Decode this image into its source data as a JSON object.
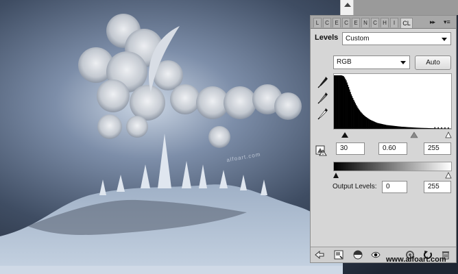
{
  "canvas": {
    "artwork_signature": "alfoart.com"
  },
  "panel": {
    "tabs": [
      "L",
      "C",
      "E",
      "C",
      "E",
      "N",
      "C",
      "H",
      "I",
      "S"
    ],
    "active_tab": "CL",
    "more_glyph": "▸▸",
    "menu_glyph": "▾≡",
    "title": "Levels",
    "preset": {
      "label": "Levels",
      "value": "Custom"
    },
    "channel": {
      "value": "RGB"
    },
    "auto_label": "Auto",
    "input_levels": {
      "black": "30",
      "gamma": "0.60",
      "white": "255"
    },
    "output_levels": {
      "label": "Output Levels:",
      "black": "0",
      "white": "255"
    },
    "histogram": {
      "note_values": [
        1,
        1,
        1,
        1,
        0.98,
        0.9,
        0.78,
        0.65,
        0.55,
        0.46,
        0.38,
        0.32,
        0.27,
        0.23,
        0.2,
        0.17,
        0.15,
        0.13,
        0.11,
        0.1,
        0.09,
        0.08,
        0.07,
        0.065,
        0.06,
        0.055,
        0.05,
        0.045,
        0.04,
        0.037,
        0.034,
        0.03,
        0.028,
        0.025,
        0.022,
        0.02,
        0.018,
        0.016,
        0.015,
        0.014,
        0.012,
        0.011,
        0.01,
        0.009,
        0.008,
        0.007,
        0.007,
        0.006,
        0.006,
        0.005
      ]
    },
    "colors": {
      "panel_bg": "#d6d6d6",
      "accent": "#000000"
    }
  },
  "footer": {
    "watermark": "www.alfoart.com"
  }
}
